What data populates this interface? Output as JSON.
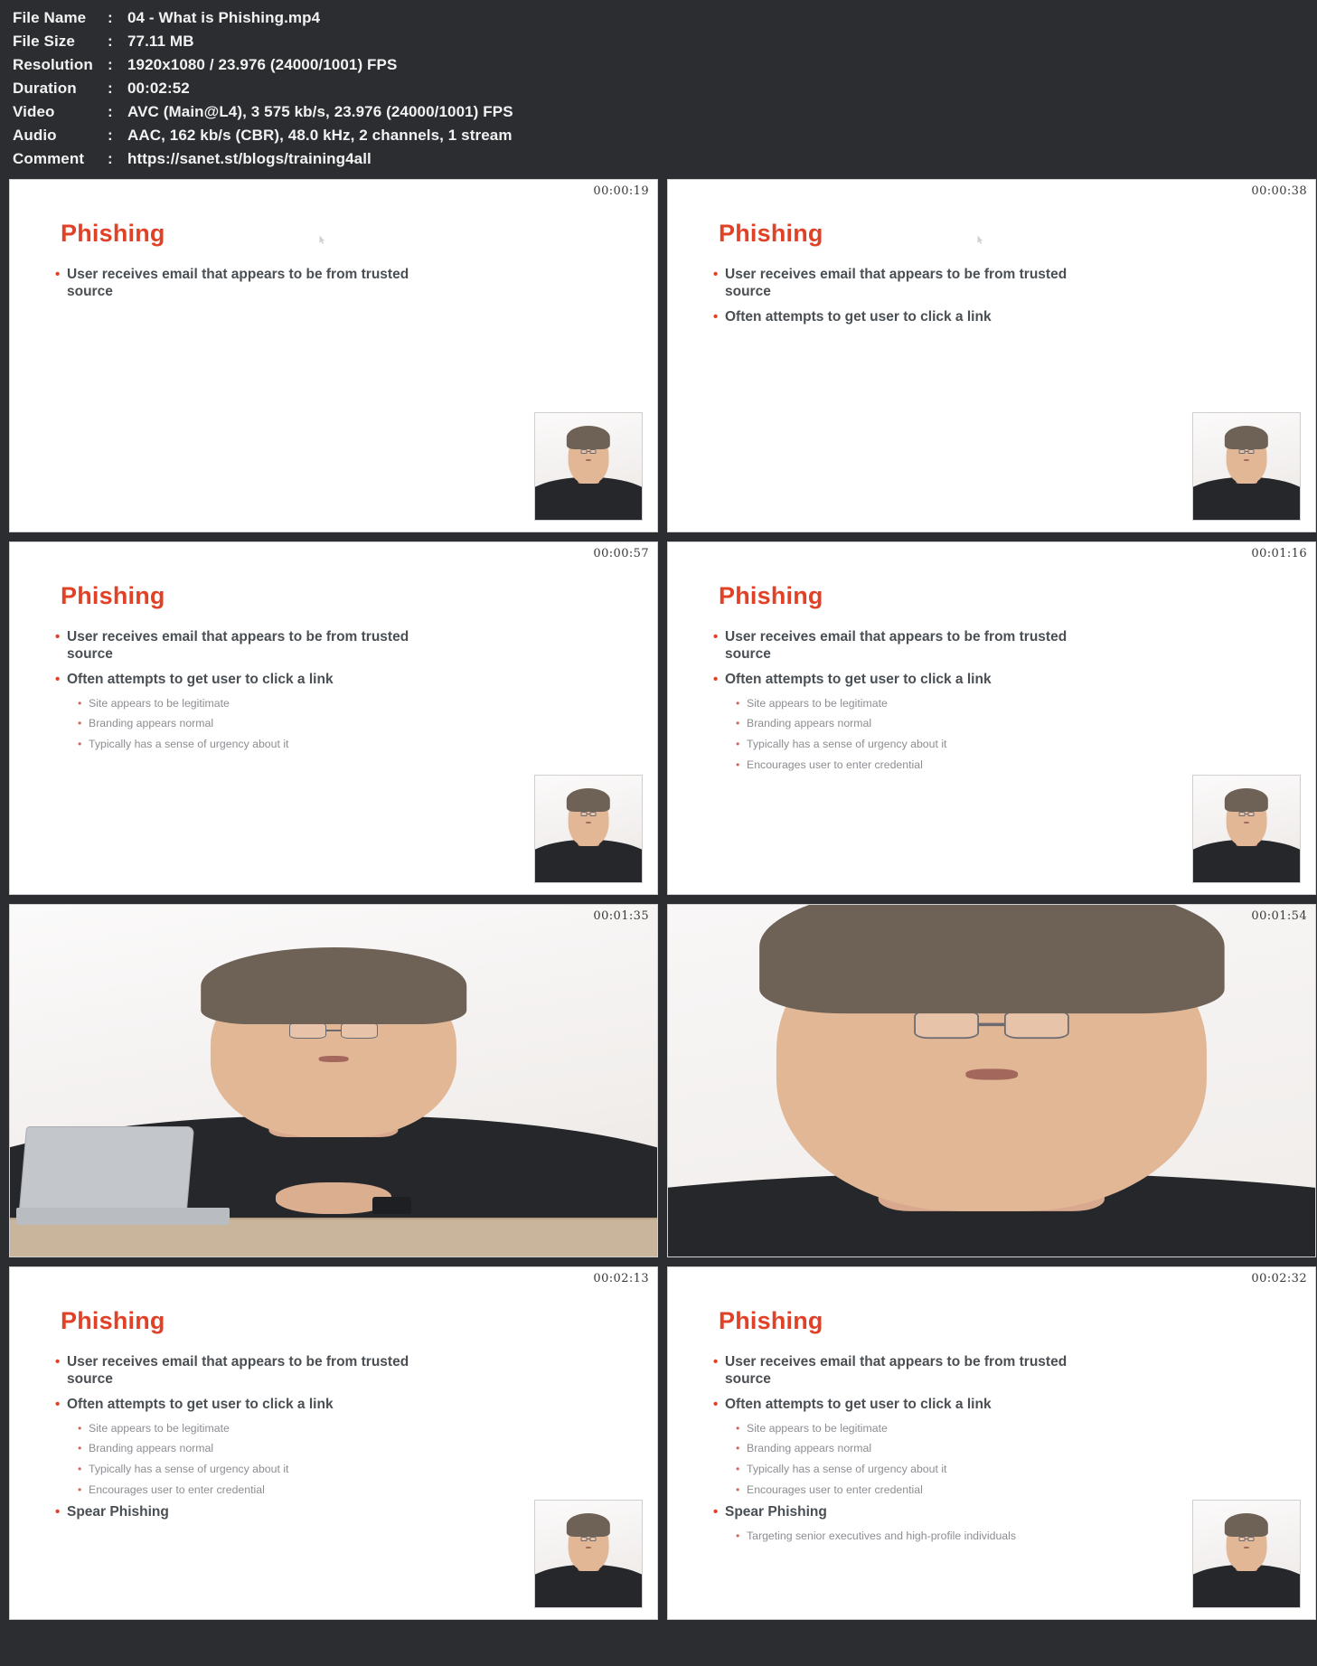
{
  "media_info": {
    "rows": [
      {
        "label": "File Name",
        "value": "04 - What is Phishing.mp4"
      },
      {
        "label": "File Size",
        "value": "77.11 MB"
      },
      {
        "label": "Resolution",
        "value": "1920x1080 / 23.976 (24000/1001) FPS"
      },
      {
        "label": "Duration",
        "value": "00:02:52"
      },
      {
        "label": "Video",
        "value": "AVC (Main@L4), 3 575 kb/s, 23.976 (24000/1001) FPS"
      },
      {
        "label": "Audio",
        "value": "AAC, 162 kb/s (CBR), 48.0 kHz, 2 channels, 1 stream"
      },
      {
        "label": "Comment",
        "value": "https://sanet.st/blogs/training4all"
      }
    ],
    "separator": ":"
  },
  "theme": {
    "header_background": "#2b2d30",
    "slide_title_color": "#e04228",
    "bullet_text_color": "#4a4f54",
    "subbullet_text_color": "#8d8d93",
    "timestamp_color": "#3a3a3a"
  },
  "thumbnails": [
    {
      "index": 1,
      "timestamp": "00:00:19",
      "kind": "slide",
      "title": "Phishing",
      "bullets": [
        {
          "level": 1,
          "text": "User receives email that appears to be from trusted source"
        }
      ],
      "has_pip": true,
      "has_cursor_artifact": true
    },
    {
      "index": 2,
      "timestamp": "00:00:38",
      "kind": "slide",
      "title": "Phishing",
      "bullets": [
        {
          "level": 1,
          "text": "User receives email that appears to be from trusted source"
        },
        {
          "level": 1,
          "text": "Often attempts to get user to click a link"
        }
      ],
      "has_pip": true,
      "has_cursor_artifact": true
    },
    {
      "index": 3,
      "timestamp": "00:00:57",
      "kind": "slide",
      "title": "Phishing",
      "bullets": [
        {
          "level": 1,
          "text": "User receives email that appears to be from trusted source"
        },
        {
          "level": 1,
          "text": "Often attempts to get user to click a link"
        },
        {
          "level": 2,
          "text": "Site appears to be legitimate"
        },
        {
          "level": 2,
          "text": "Branding appears normal"
        },
        {
          "level": 2,
          "text": "Typically has a sense of urgency about it"
        }
      ],
      "has_pip": true,
      "has_cursor_artifact": false
    },
    {
      "index": 4,
      "timestamp": "00:01:16",
      "kind": "slide",
      "title": "Phishing",
      "bullets": [
        {
          "level": 1,
          "text": "User receives email that appears to be from trusted source"
        },
        {
          "level": 1,
          "text": "Often attempts to get user to click a link"
        },
        {
          "level": 2,
          "text": "Site appears to be legitimate"
        },
        {
          "level": 2,
          "text": "Branding appears normal"
        },
        {
          "level": 2,
          "text": "Typically has a sense of urgency about it"
        },
        {
          "level": 2,
          "text": "Encourages user to enter credential"
        }
      ],
      "has_pip": true,
      "has_cursor_artifact": false
    },
    {
      "index": 5,
      "timestamp": "00:01:35",
      "kind": "video-frame",
      "scene": "presenter-at-desk-with-laptop",
      "has_pip": false
    },
    {
      "index": 6,
      "timestamp": "00:01:54",
      "kind": "video-frame",
      "scene": "presenter-closeup",
      "has_pip": false
    },
    {
      "index": 7,
      "timestamp": "00:02:13",
      "kind": "slide",
      "title": "Phishing",
      "bullets": [
        {
          "level": 1,
          "text": "User receives email that appears to be from trusted source"
        },
        {
          "level": 1,
          "text": "Often attempts to get user to click a link"
        },
        {
          "level": 2,
          "text": "Site appears to be legitimate"
        },
        {
          "level": 2,
          "text": "Branding appears normal"
        },
        {
          "level": 2,
          "text": "Typically has a sense of urgency about it"
        },
        {
          "level": 2,
          "text": "Encourages user to enter credential"
        },
        {
          "level": 1,
          "text": "Spear Phishing"
        }
      ],
      "has_pip": true,
      "has_cursor_artifact": false
    },
    {
      "index": 8,
      "timestamp": "00:02:32",
      "kind": "slide",
      "title": "Phishing",
      "bullets": [
        {
          "level": 1,
          "text": "User receives email that appears to be from trusted source"
        },
        {
          "level": 1,
          "text": "Often attempts to get user to click a link"
        },
        {
          "level": 2,
          "text": "Site appears to be legitimate"
        },
        {
          "level": 2,
          "text": "Branding appears normal"
        },
        {
          "level": 2,
          "text": "Typically has a sense of urgency about it"
        },
        {
          "level": 2,
          "text": "Encourages user to enter credential"
        },
        {
          "level": 1,
          "text": "Spear Phishing"
        },
        {
          "level": 2,
          "text": "Targeting senior executives and high-profile individuals"
        }
      ],
      "has_pip": true,
      "has_cursor_artifact": false
    }
  ]
}
